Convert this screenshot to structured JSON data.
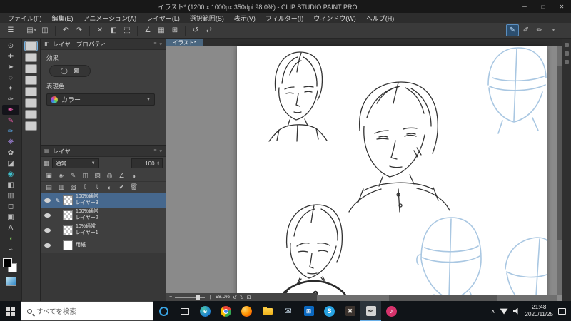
{
  "titlebar": {
    "title": "イラスト* (1200 x 1000px 350dpi 98.0%) - CLIP STUDIO PAINT PRO"
  },
  "menubar": {
    "items": [
      "ファイル(F)",
      "編集(E)",
      "アニメーション(A)",
      "レイヤー(L)",
      "選択範囲(S)",
      "表示(V)",
      "フィルター(I)",
      "ウィンドウ(W)",
      "ヘルプ(H)"
    ]
  },
  "document": {
    "tab": "イラスト*",
    "zoom": "98.0%"
  },
  "layer_property": {
    "title": "レイヤープロパティ",
    "effect_label": "効果",
    "expression_color_label": "表現色",
    "expression_color_value": "カラー"
  },
  "layer": {
    "title": "レイヤー",
    "blend_mode": "通常",
    "opacity": "100",
    "layers": [
      {
        "info": "100%通常",
        "name": "レイヤー3"
      },
      {
        "info": "100%通常",
        "name": "レイヤー2"
      },
      {
        "info": "10%通常",
        "name": "レイヤー1"
      },
      {
        "info": "",
        "name": "用紙"
      }
    ]
  },
  "taskbar": {
    "search_placeholder": "すべてを検索",
    "time": "21:48",
    "date": "2020/11/25"
  },
  "colors": {
    "accent_blue": "#6ab0e8",
    "selected_layer": "#46688e",
    "sketch_ink": "#333333",
    "sketch_rough": "#a9c7e2"
  }
}
